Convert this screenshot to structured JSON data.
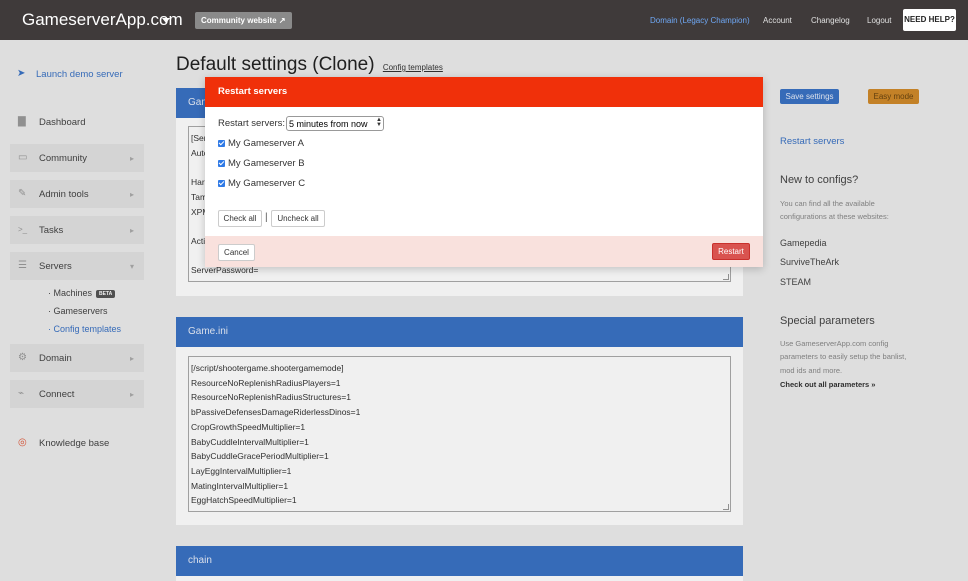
{
  "topbar": {
    "brand": "GameserverApp.com",
    "community_label": "Community website",
    "nav": {
      "domain": "Domain (Legacy Champion)",
      "account": "Account",
      "changelog": "Changelog",
      "logout": "Logout"
    },
    "help": "NEED HELP?"
  },
  "sidebar": {
    "launch": "Launch demo server",
    "items": [
      {
        "label": "Dashboard",
        "icon": "chart-icon"
      },
      {
        "label": "Community",
        "icon": "window-icon"
      },
      {
        "label": "Admin tools",
        "icon": "pencil-icon"
      },
      {
        "label": "Tasks",
        "icon": "terminal-icon"
      },
      {
        "label": "Servers",
        "icon": "server-icon"
      },
      {
        "label": "Domain",
        "icon": "gear-icon"
      },
      {
        "label": "Connect",
        "icon": "plug-icon"
      },
      {
        "label": "Knowledge base",
        "icon": "lifebuoy-icon"
      }
    ],
    "sub": {
      "machines": "Machines",
      "beta": "BETA",
      "gameservers": "Gameservers",
      "config_templates": "Config templates"
    }
  },
  "main": {
    "title": "Default settings (Clone)",
    "title_link": "Config templates",
    "card1": {
      "header": "Gam",
      "lines": [
        "[Ser",
        "Auto",
        "",
        "Har",
        "Tam",
        "XPM",
        "",
        "Acti",
        "",
        "ServerPassword="
      ]
    },
    "card2": {
      "header": "Game.ini",
      "lines": [
        "[/script/shootergame.shootergamemode]",
        "ResourceNoReplenishRadiusPlayers=1",
        "ResourceNoReplenishRadiusStructures=1",
        "bPassiveDefensesDamageRiderlessDinos=1",
        "CropGrowthSpeedMultiplier=1",
        "BabyCuddleIntervalMultiplier=1",
        "BabyCuddleGracePeriodMultiplier=1",
        "LayEggIntervalMultiplier=1",
        "MatingIntervalMultiplier=1",
        "EggHatchSpeedMultiplier=1"
      ]
    },
    "card3": {
      "header": "chain"
    }
  },
  "right": {
    "save": "Save settings",
    "easy": "Easy mode",
    "restart_link": "Restart servers",
    "new_title": "New to configs?",
    "new_text1": "You can find all the available",
    "new_text2": "configurations at these websites:",
    "links": [
      "Gamepedia",
      "SurviveTheArk",
      "STEAM"
    ],
    "special_title": "Special parameters",
    "special_text1": "Use GameserverApp.com config",
    "special_text2": "parameters to easily setup the banlist,",
    "special_text3": "mod ids and more.",
    "special_link": "Check out all parameters »"
  },
  "modal": {
    "title": "Restart servers",
    "restart_label": "Restart servers:",
    "selected_time": "5 minutes from now",
    "servers": [
      "My Gameserver A",
      "My Gameserver B",
      "My Gameserver C"
    ],
    "check_all": "Check all",
    "separator": "|",
    "uncheck_all": "Uncheck all",
    "cancel": "Cancel",
    "restart": "Restart"
  },
  "colors": {
    "accent": "#3a72c4",
    "modal_header": "#f0300a",
    "restart_button": "#d9534f",
    "topbar": "#3f3a3a"
  }
}
